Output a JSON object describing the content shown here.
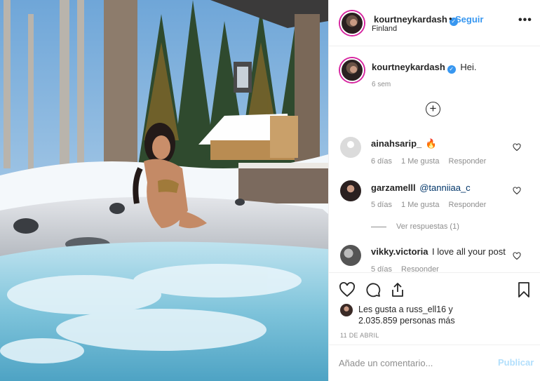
{
  "post": {
    "image_alt": "Woman in a hot tub surrounded by snowy pine forest",
    "username": "kourtneykardash",
    "follow_label": "Seguir",
    "separator": "•",
    "location": "Finland",
    "more_label": "•••"
  },
  "caption": {
    "username": "kourtneykardash",
    "text": "Hei.",
    "time": "6 sem"
  },
  "comments": [
    {
      "username": "ainahsarip_",
      "text": "🔥",
      "time": "6 días",
      "likes": "1 Me gusta",
      "reply": "Responder"
    },
    {
      "username": "garzamelll",
      "text": "@tanniiaa_c",
      "time": "5 días",
      "likes": "1 Me gusta",
      "reply": "Responder",
      "view_replies": "Ver respuestas (1)"
    },
    {
      "username": "vikky.victoria",
      "text": "I love all your post",
      "time": "5 días",
      "reply": "Responder"
    }
  ],
  "likes": {
    "line1": "Les gusta a russ_ell16 y",
    "line2": "2.035.859 personas más"
  },
  "date": "11 DE ABRIL",
  "add_comment": {
    "placeholder": "Añade un comentario...",
    "publish": "Publicar"
  },
  "colors": {
    "accent": "#3897f0",
    "publish_disabled": "#b2dffc",
    "muted": "#8e8e8e"
  },
  "icons": [
    "heart-icon",
    "comment-icon",
    "share-icon",
    "bookmark-icon",
    "verified-badge-icon",
    "plus-circle-icon"
  ]
}
